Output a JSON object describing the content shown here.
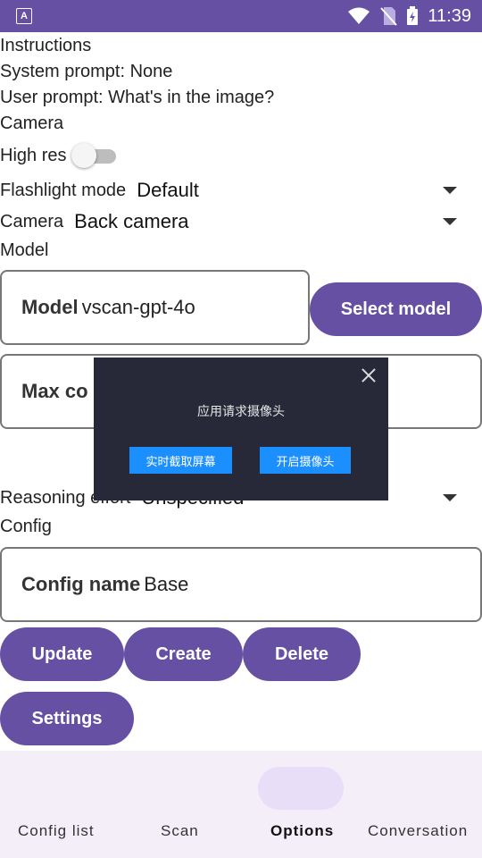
{
  "status": {
    "time": "11:39",
    "app_icon_letter": "A"
  },
  "instructions": {
    "heading": "Instructions",
    "system_prompt": "System prompt: None",
    "user_prompt": "User prompt: What's in the image?"
  },
  "camera": {
    "heading": "Camera",
    "high_res_label": "High res",
    "high_res_on": false,
    "flashlight_label": "Flashlight mode",
    "flashlight_value": "Default",
    "camera_label": "Camera",
    "camera_value": "Back camera"
  },
  "model": {
    "heading": "Model",
    "model_label": "Model",
    "model_value": "vscan-gpt-4o",
    "select_label": "Select model",
    "max_label": "Max co",
    "reasoning_label": "Reasoning effort",
    "reasoning_value": "Unspecified"
  },
  "config": {
    "heading": "Config",
    "name_label": "Config name",
    "name_value": "Base",
    "update_label": "Update",
    "create_label": "Create",
    "delete_label": "Delete",
    "settings_label": "Settings"
  },
  "nav": {
    "items": [
      "Config list",
      "Scan",
      "Options",
      "Conversation"
    ],
    "active": "Options"
  },
  "dialog": {
    "message": "应用请求摄像头",
    "btn_screen": "实时截取屏幕",
    "btn_camera": "开启摄像头"
  },
  "colors": {
    "accent": "#6650a4",
    "dialog_bg": "#272838",
    "dialog_btn": "#1c8fff"
  }
}
